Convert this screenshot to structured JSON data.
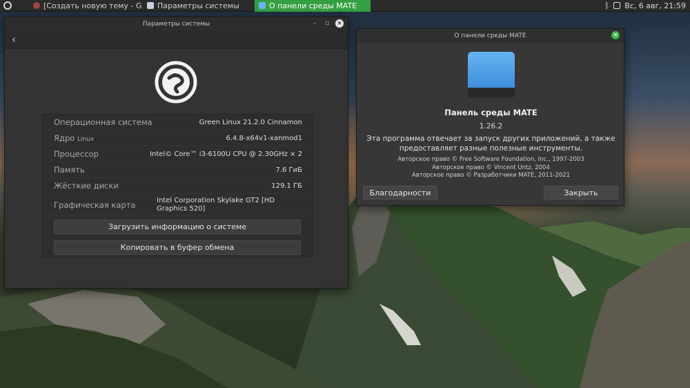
{
  "panel": {
    "tasks": [
      {
        "label": "[Создать новую тему - G..."
      },
      {
        "label": "Параметры системы"
      },
      {
        "label": "О панели среды MATE"
      }
    ],
    "clock": "Вс, 6 авг, 21:59",
    "active_color": "#35a041"
  },
  "settings": {
    "title": "Параметры системы",
    "rows": [
      {
        "key": "Операционная система",
        "value": "Green Linux 21.2.0 Cinnamon"
      },
      {
        "key": "Ядро",
        "key_small": "Linux",
        "value": "6.4.8-x64v1-xanmod1"
      },
      {
        "key": "Процессор",
        "value": "Intel© Core™ i3-6100U CPU @ 2.30GHz × 2"
      },
      {
        "key": "Память",
        "value": "7.6 ГиБ"
      },
      {
        "key": "Жёсткие диски",
        "value": "129.1 ГБ"
      },
      {
        "key": "Графическая карта",
        "value": "Intel Corporation Skylake GT2 [HD Graphics 520]"
      }
    ],
    "upload_button": "Загрузить информацию о системе",
    "copy_button": "Копировать в буфер обмена"
  },
  "about": {
    "title": "О панели среды MATE",
    "app_name": "Панель среды MATE",
    "version": "1.26.2",
    "description_1": "Эта программа отвечает за запуск других приложений, а также",
    "description_2": "предоставляет разные полезные инструменты.",
    "copyright_1": "Авторское право © Free Software Foundation, Inc., 1997-2003",
    "copyright_2": "Авторское право © Vincent Untz, 2004",
    "copyright_3": "Авторское право © Разработчики MATE, 2011-2021",
    "credits_button": "Благодарности",
    "close_button": "Закрыть",
    "icon_color": "#4f9fe8"
  }
}
